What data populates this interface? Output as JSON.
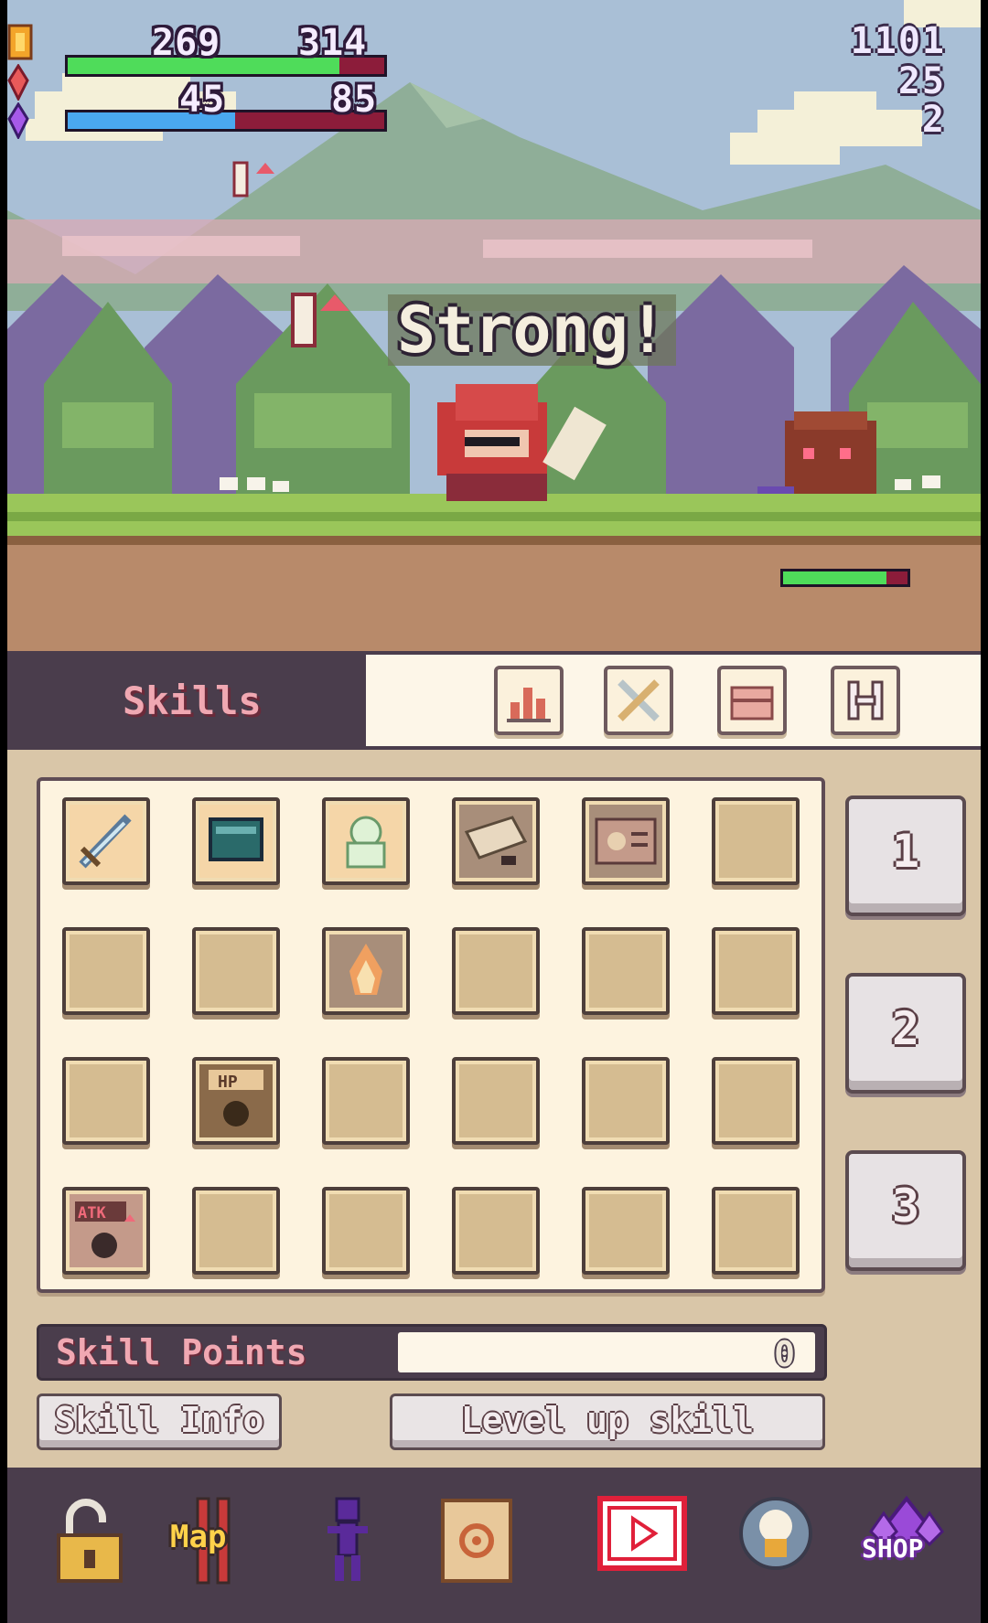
{
  "hud": {
    "hp_current": "269",
    "hp_max": "314",
    "hp_fraction": 0.857,
    "mp_current": "45",
    "mp_max": "85",
    "mp_fraction": 0.53,
    "gold": "1101",
    "red_gems": "25",
    "purple_gems": "2",
    "enemy_hp_fraction": 0.83
  },
  "battle": {
    "popup_text": "Strong!"
  },
  "tabs": {
    "skills_label": "Skills"
  },
  "skill_slots": [
    {
      "icon": "sword-icon"
    },
    {
      "icon": "book-icon"
    },
    {
      "icon": "ghost-icon"
    },
    {
      "icon": "scroll-icon"
    },
    {
      "icon": "rock-card-icon"
    },
    {
      "icon": ""
    },
    {
      "icon": ""
    },
    {
      "icon": ""
    },
    {
      "icon": "fire-icon"
    },
    {
      "icon": ""
    },
    {
      "icon": ""
    },
    {
      "icon": ""
    },
    {
      "icon": ""
    },
    {
      "icon": "hp-potion-icon"
    },
    {
      "icon": ""
    },
    {
      "icon": ""
    },
    {
      "icon": ""
    },
    {
      "icon": ""
    },
    {
      "icon": "atk-boost-icon"
    },
    {
      "icon": ""
    },
    {
      "icon": ""
    },
    {
      "icon": ""
    },
    {
      "icon": ""
    },
    {
      "icon": ""
    }
  ],
  "hp_icon_text": "HP",
  "atk_icon_text": "ATK",
  "page_buttons": [
    "1",
    "2",
    "3"
  ],
  "skill_points": {
    "label": "Skill Points",
    "value": "0"
  },
  "actions": {
    "skill_info": "Skill Info",
    "level_up": "Level up skill"
  },
  "nav": {
    "map_label": "Map",
    "shop_label": "SHOP"
  },
  "colors": {
    "hp_bar": "#4fdc5a",
    "mp_bar": "#4aa8f0",
    "bar_bg": "#8c1c3a",
    "panel": "#d9c6a8",
    "dark": "#4a3d4c"
  }
}
